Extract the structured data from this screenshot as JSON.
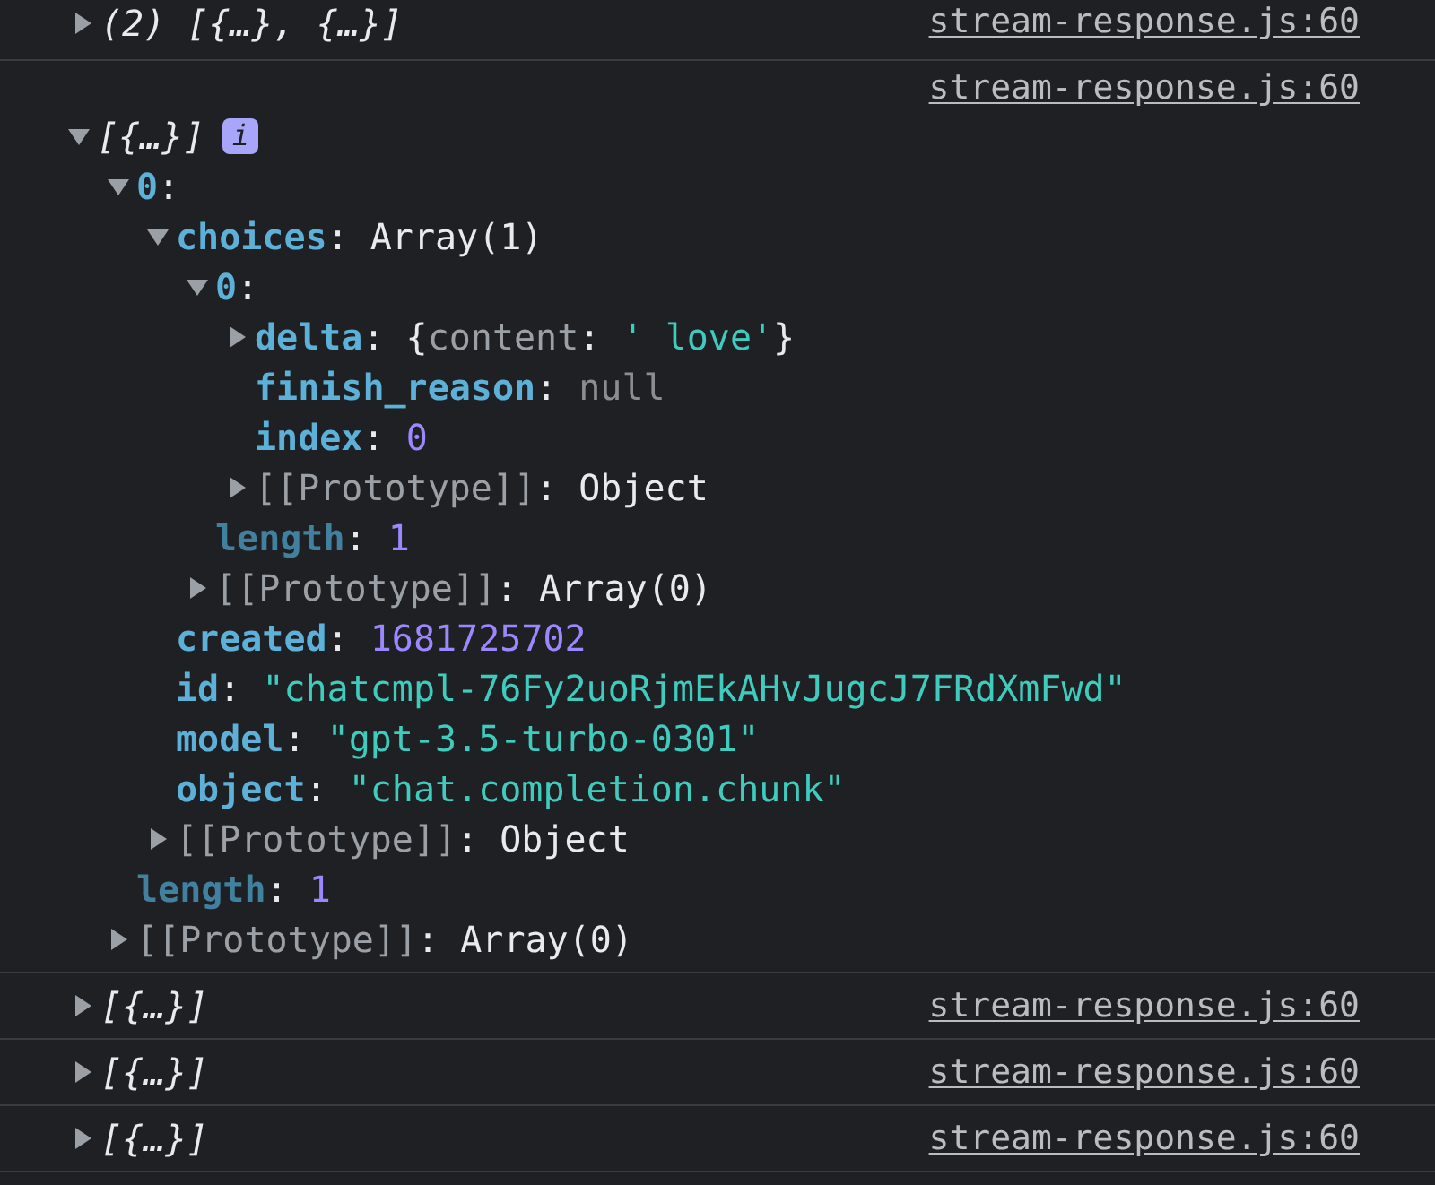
{
  "messages": [
    {
      "summary": "(2) [{…}, {…}]",
      "source": "stream-response.js:60",
      "expanded": false
    },
    {
      "summary": "[{…}]",
      "badge": "i",
      "source": "stream-response.js:60",
      "expanded": true,
      "children": [
        {
          "parts": [
            {
              "text": "0",
              "kind": "key"
            },
            {
              "text": ":",
              "kind": "punct"
            }
          ],
          "expanded": true,
          "children": [
            {
              "parts": [
                {
                  "text": "choices",
                  "kind": "key"
                },
                {
                  "text": ": ",
                  "kind": "punct"
                },
                {
                  "text": "Array(1)",
                  "kind": "object"
                }
              ],
              "expanded": true,
              "children": [
                {
                  "parts": [
                    {
                      "text": "0",
                      "kind": "key"
                    },
                    {
                      "text": ":",
                      "kind": "punct"
                    }
                  ],
                  "expanded": true,
                  "children": [
                    {
                      "parts": [
                        {
                          "text": "delta",
                          "kind": "key"
                        },
                        {
                          "text": ": {",
                          "kind": "punct"
                        },
                        {
                          "text": "content",
                          "kind": "preview_key"
                        },
                        {
                          "text": ": ",
                          "kind": "punct"
                        },
                        {
                          "text": "' love'",
                          "kind": "string"
                        },
                        {
                          "text": "}",
                          "kind": "punct"
                        }
                      ],
                      "expanded": false
                    },
                    {
                      "parts": [
                        {
                          "text": "finish_reason",
                          "kind": "key"
                        },
                        {
                          "text": ": ",
                          "kind": "punct"
                        },
                        {
                          "text": "null",
                          "kind": "null"
                        }
                      ]
                    },
                    {
                      "parts": [
                        {
                          "text": "index",
                          "kind": "key"
                        },
                        {
                          "text": ": ",
                          "kind": "punct"
                        },
                        {
                          "text": "0",
                          "kind": "number"
                        }
                      ]
                    },
                    {
                      "parts": [
                        {
                          "text": "[[Prototype]]",
                          "kind": "internal"
                        },
                        {
                          "text": ": ",
                          "kind": "punct"
                        },
                        {
                          "text": "Object",
                          "kind": "object"
                        }
                      ],
                      "expanded": false
                    }
                  ]
                },
                {
                  "parts": [
                    {
                      "text": "length",
                      "kind": "nonenum"
                    },
                    {
                      "text": ": ",
                      "kind": "punct"
                    },
                    {
                      "text": "1",
                      "kind": "number"
                    }
                  ]
                },
                {
                  "parts": [
                    {
                      "text": "[[Prototype]]",
                      "kind": "internal"
                    },
                    {
                      "text": ": ",
                      "kind": "punct"
                    },
                    {
                      "text": "Array(0)",
                      "kind": "object"
                    }
                  ],
                  "expanded": false
                }
              ]
            },
            {
              "parts": [
                {
                  "text": "created",
                  "kind": "key"
                },
                {
                  "text": ": ",
                  "kind": "punct"
                },
                {
                  "text": "1681725702",
                  "kind": "number"
                }
              ]
            },
            {
              "parts": [
                {
                  "text": "id",
                  "kind": "key"
                },
                {
                  "text": ": ",
                  "kind": "punct"
                },
                {
                  "text": "\"chatcmpl-76Fy2uoRjmEkAHvJugcJ7FRdXmFwd\"",
                  "kind": "string"
                }
              ]
            },
            {
              "parts": [
                {
                  "text": "model",
                  "kind": "key"
                },
                {
                  "text": ": ",
                  "kind": "punct"
                },
                {
                  "text": "\"gpt-3.5-turbo-0301\"",
                  "kind": "string"
                }
              ]
            },
            {
              "parts": [
                {
                  "text": "object",
                  "kind": "key"
                },
                {
                  "text": ": ",
                  "kind": "punct"
                },
                {
                  "text": "\"chat.completion.chunk\"",
                  "kind": "string"
                }
              ]
            },
            {
              "parts": [
                {
                  "text": "[[Prototype]]",
                  "kind": "internal"
                },
                {
                  "text": ": ",
                  "kind": "punct"
                },
                {
                  "text": "Object",
                  "kind": "object"
                }
              ],
              "expanded": false
            }
          ]
        },
        {
          "parts": [
            {
              "text": "length",
              "kind": "nonenum"
            },
            {
              "text": ": ",
              "kind": "punct"
            },
            {
              "text": "1",
              "kind": "number"
            }
          ]
        },
        {
          "parts": [
            {
              "text": "[[Prototype]]",
              "kind": "internal"
            },
            {
              "text": ": ",
              "kind": "punct"
            },
            {
              "text": "Array(0)",
              "kind": "object"
            }
          ],
          "expanded": false
        }
      ]
    },
    {
      "summary": "[{…}]",
      "source": "stream-response.js:60",
      "expanded": false
    },
    {
      "summary": "[{…}]",
      "source": "stream-response.js:60",
      "expanded": false
    },
    {
      "summary": "[{…}]",
      "source": "stream-response.js:60",
      "expanded": false
    }
  ]
}
